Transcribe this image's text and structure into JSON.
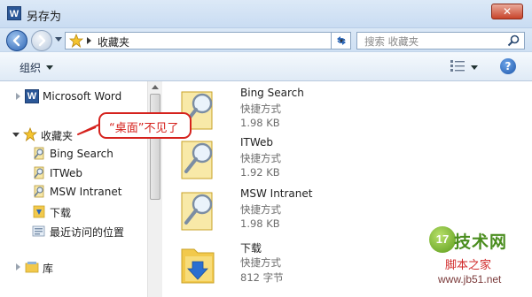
{
  "window": {
    "title": "另存为",
    "app_icon": "W",
    "close_label": "✕"
  },
  "address": {
    "path": "收藏夹",
    "search_placeholder": "搜索 收藏夹"
  },
  "toolbar": {
    "organize_label": "组织",
    "help_label": "?"
  },
  "nav": {
    "items": [
      {
        "label": "Microsoft Word",
        "icon": "word-icon"
      },
      {
        "label": "收藏夹",
        "icon": "favorites-star-icon"
      },
      {
        "label": "Bing Search",
        "icon": "shortcut-link-icon"
      },
      {
        "label": "ITWeb",
        "icon": "shortcut-link-icon"
      },
      {
        "label": "MSW Intranet",
        "icon": "shortcut-link-icon"
      },
      {
        "label": "下载",
        "icon": "downloads-folder-icon"
      },
      {
        "label": "最近访问的位置",
        "icon": "recent-places-icon"
      },
      {
        "label": "库",
        "icon": "library-icon"
      }
    ]
  },
  "callout": {
    "text": "“桌面”不见了"
  },
  "files": [
    {
      "name": "Bing Search",
      "type": "快捷方式",
      "size": "1.98 KB",
      "icon": "shortcut-magnifier-icon"
    },
    {
      "name": "ITWeb",
      "type": "快捷方式",
      "size": "1.92 KB",
      "icon": "shortcut-magnifier-icon"
    },
    {
      "name": "MSW Intranet",
      "type": "快捷方式",
      "size": "1.98 KB",
      "icon": "shortcut-magnifier-icon"
    },
    {
      "name": "下载",
      "type": "快捷方式",
      "size": "812 字节",
      "icon": "downloads-folder-icon"
    }
  ],
  "watermark": {
    "badge": "17",
    "main": "技术网",
    "sub": "脚本之家",
    "url": "www.jb51.net"
  },
  "colors": {
    "callout_red": "#d5221d",
    "window_frame": "#dce9f7",
    "folder_yellow": "#f2c94c"
  }
}
